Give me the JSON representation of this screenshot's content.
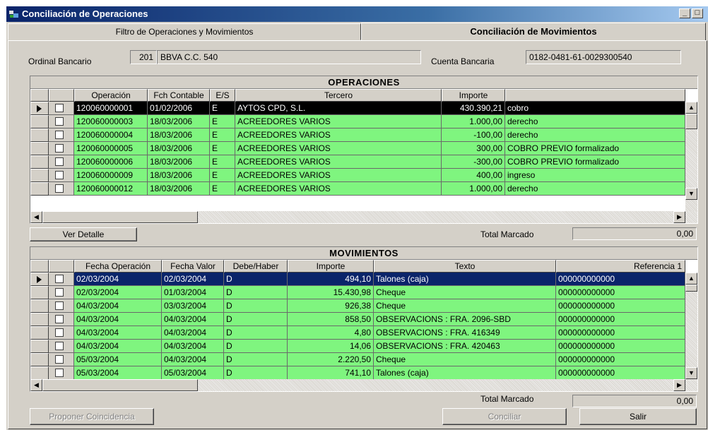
{
  "window": {
    "title": "Conciliación de Operaciones",
    "min": "_",
    "max": "□"
  },
  "tabs": [
    {
      "label": "Filtro de Operaciones y Movimientos"
    },
    {
      "label": "Conciliación de Movimientos"
    }
  ],
  "header": {
    "ordinal_label": "Ordinal Bancario",
    "ordinal_code": "201",
    "ordinal_name": "BBVA C.C. 540",
    "cuenta_label": "Cuenta Bancaria",
    "cuenta_value": "0182-0481-61-0029300540"
  },
  "operaciones": {
    "title": "OPERACIONES",
    "columns": [
      "Operación",
      "Fch Contable",
      "E/S",
      "Tercero",
      "Importe",
      ""
    ],
    "rows": [
      {
        "op": "120060000001",
        "fecha": "01/02/2006",
        "es": "E",
        "tercero": "AYTOS CPD, S.L.",
        "importe": "430.390,21",
        "desc": "cobro"
      },
      {
        "op": "120060000003",
        "fecha": "18/03/2006",
        "es": "E",
        "tercero": "ACREEDORES VARIOS",
        "importe": "1.000,00",
        "desc": "derecho"
      },
      {
        "op": "120060000004",
        "fecha": "18/03/2006",
        "es": "E",
        "tercero": "ACREEDORES VARIOS",
        "importe": "-100,00",
        "desc": "derecho"
      },
      {
        "op": "120060000005",
        "fecha": "18/03/2006",
        "es": "E",
        "tercero": "ACREEDORES VARIOS",
        "importe": "300,00",
        "desc": "COBRO PREVIO formalizado"
      },
      {
        "op": "120060000006",
        "fecha": "18/03/2006",
        "es": "E",
        "tercero": "ACREEDORES VARIOS",
        "importe": "-300,00",
        "desc": "COBRO PREVIO formalizado"
      },
      {
        "op": "120060000009",
        "fecha": "18/03/2006",
        "es": "E",
        "tercero": "ACREEDORES VARIOS",
        "importe": "400,00",
        "desc": "ingreso"
      },
      {
        "op": "120060000012",
        "fecha": "18/03/2006",
        "es": "E",
        "tercero": "ACREEDORES VARIOS",
        "importe": "1.000,00",
        "desc": "derecho"
      }
    ],
    "ver_detalle": "Ver Detalle",
    "total_label": "Total Marcado",
    "total_value": "0,00"
  },
  "movimientos": {
    "title": "MOVIMIENTOS",
    "columns": [
      "Fecha Operación",
      "Fecha Valor",
      "Debe/Haber",
      "Importe",
      "Texto",
      "Referencia 1"
    ],
    "rows": [
      {
        "fop": "02/03/2004",
        "fval": "02/03/2004",
        "dh": "D",
        "importe": "494,10",
        "texto": "Talones (caja)",
        "ref": "000000000000"
      },
      {
        "fop": "02/03/2004",
        "fval": "01/03/2004",
        "dh": "D",
        "importe": "15.430,98",
        "texto": "Cheque",
        "ref": "000000000000"
      },
      {
        "fop": "04/03/2004",
        "fval": "03/03/2004",
        "dh": "D",
        "importe": "926,38",
        "texto": "Cheque",
        "ref": "000000000000"
      },
      {
        "fop": "04/03/2004",
        "fval": "04/03/2004",
        "dh": "D",
        "importe": "858,50",
        "texto": "OBSERVACIONS : FRA. 2096-SBD",
        "ref": "000000000000"
      },
      {
        "fop": "04/03/2004",
        "fval": "04/03/2004",
        "dh": "D",
        "importe": "4,80",
        "texto": "OBSERVACIONS : FRA. 416349",
        "ref": "000000000000"
      },
      {
        "fop": "04/03/2004",
        "fval": "04/03/2004",
        "dh": "D",
        "importe": "14,06",
        "texto": "OBSERVACIONS : FRA. 420463",
        "ref": "000000000000"
      },
      {
        "fop": "05/03/2004",
        "fval": "04/03/2004",
        "dh": "D",
        "importe": "2.220,50",
        "texto": "Cheque",
        "ref": "000000000000"
      },
      {
        "fop": "05/03/2004",
        "fval": "05/03/2004",
        "dh": "D",
        "importe": "741,10",
        "texto": "Talones (caja)",
        "ref": "000000000000"
      }
    ],
    "total_label": "Total Marcado",
    "total_value": "0,00"
  },
  "buttons": {
    "proponer": "Proponer Coincidencia",
    "conciliar": "Conciliar",
    "salir": "Salir"
  },
  "colors": {
    "row_green": "#7ff57f",
    "selected_black": "#000000",
    "selected_navy": "#0a246a"
  }
}
